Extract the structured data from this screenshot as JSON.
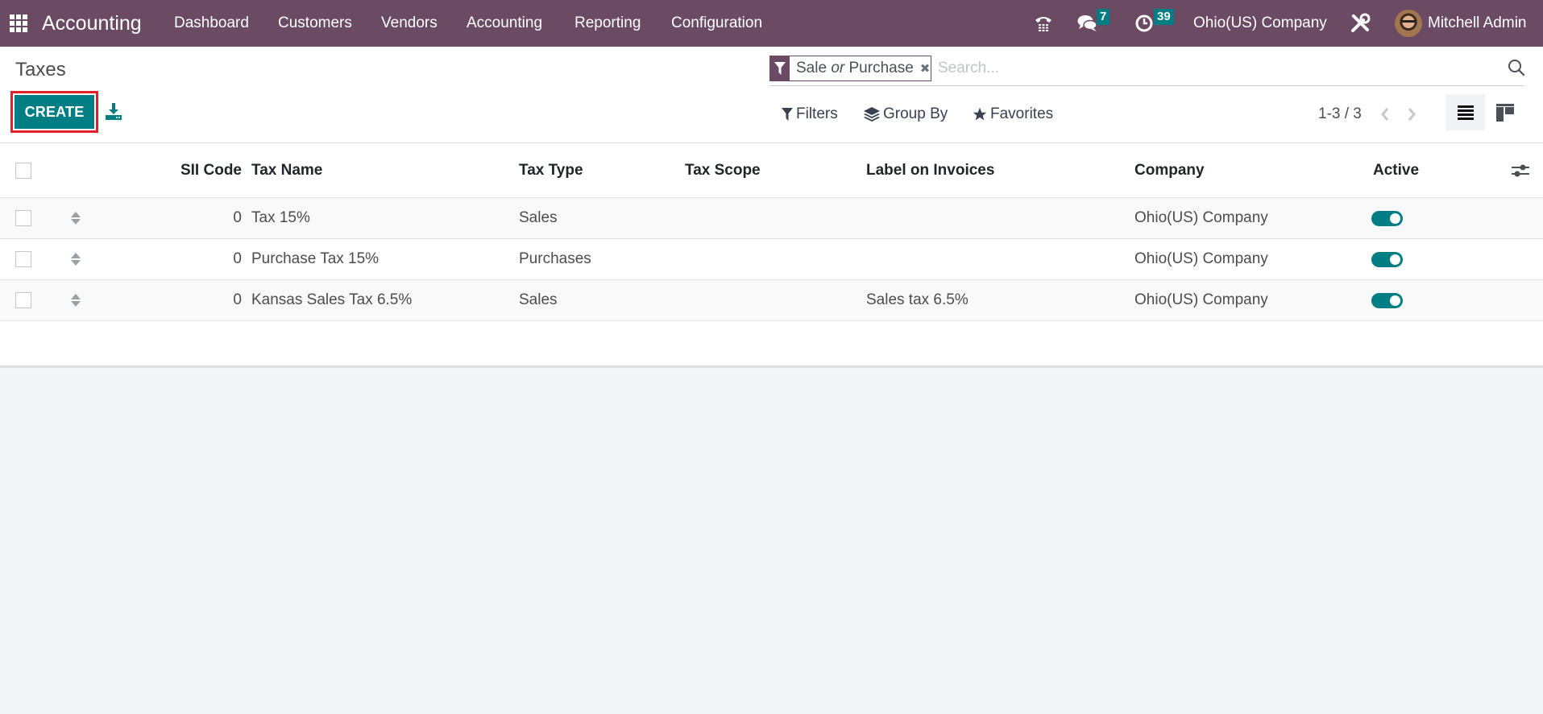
{
  "navbar": {
    "brand": "Accounting",
    "menu": [
      {
        "label": "Dashboard"
      },
      {
        "label": "Customers"
      },
      {
        "label": "Vendors"
      },
      {
        "label": "Accounting"
      },
      {
        "label": "Reporting"
      },
      {
        "label": "Configuration"
      }
    ],
    "messages_count": "7",
    "activities_count": "39",
    "company": "Ohio(US) Company",
    "user": "Mitchell Admin"
  },
  "control_panel": {
    "title": "Taxes",
    "create_label": "CREATE",
    "search": {
      "facet_part1": "Sale ",
      "facet_or": "or",
      "facet_part2": " Purchase",
      "placeholder": "Search..."
    },
    "filters_label": "Filters",
    "group_by_label": "Group By",
    "favorites_label": "Favorites",
    "pager": "1-3 / 3"
  },
  "table": {
    "columns": [
      "SII Code",
      "Tax Name",
      "Tax Type",
      "Tax Scope",
      "Label on Invoices",
      "Company",
      "Active"
    ],
    "rows": [
      {
        "sii_code": "0",
        "tax_name": "Tax 15%",
        "tax_type": "Sales",
        "tax_scope": "",
        "label_on_invoices": "",
        "company": "Ohio(US) Company",
        "active": true
      },
      {
        "sii_code": "0",
        "tax_name": "Purchase Tax 15%",
        "tax_type": "Purchases",
        "tax_scope": "",
        "label_on_invoices": "",
        "company": "Ohio(US) Company",
        "active": true
      },
      {
        "sii_code": "0",
        "tax_name": "Kansas Sales Tax 6.5%",
        "tax_type": "Sales",
        "tax_scope": "",
        "label_on_invoices": "Sales tax 6.5%",
        "company": "Ohio(US) Company",
        "active": true
      }
    ]
  },
  "colors": {
    "navbar": "#6b4a64",
    "primary": "#017e84",
    "highlight_outline": "#e0202b"
  }
}
